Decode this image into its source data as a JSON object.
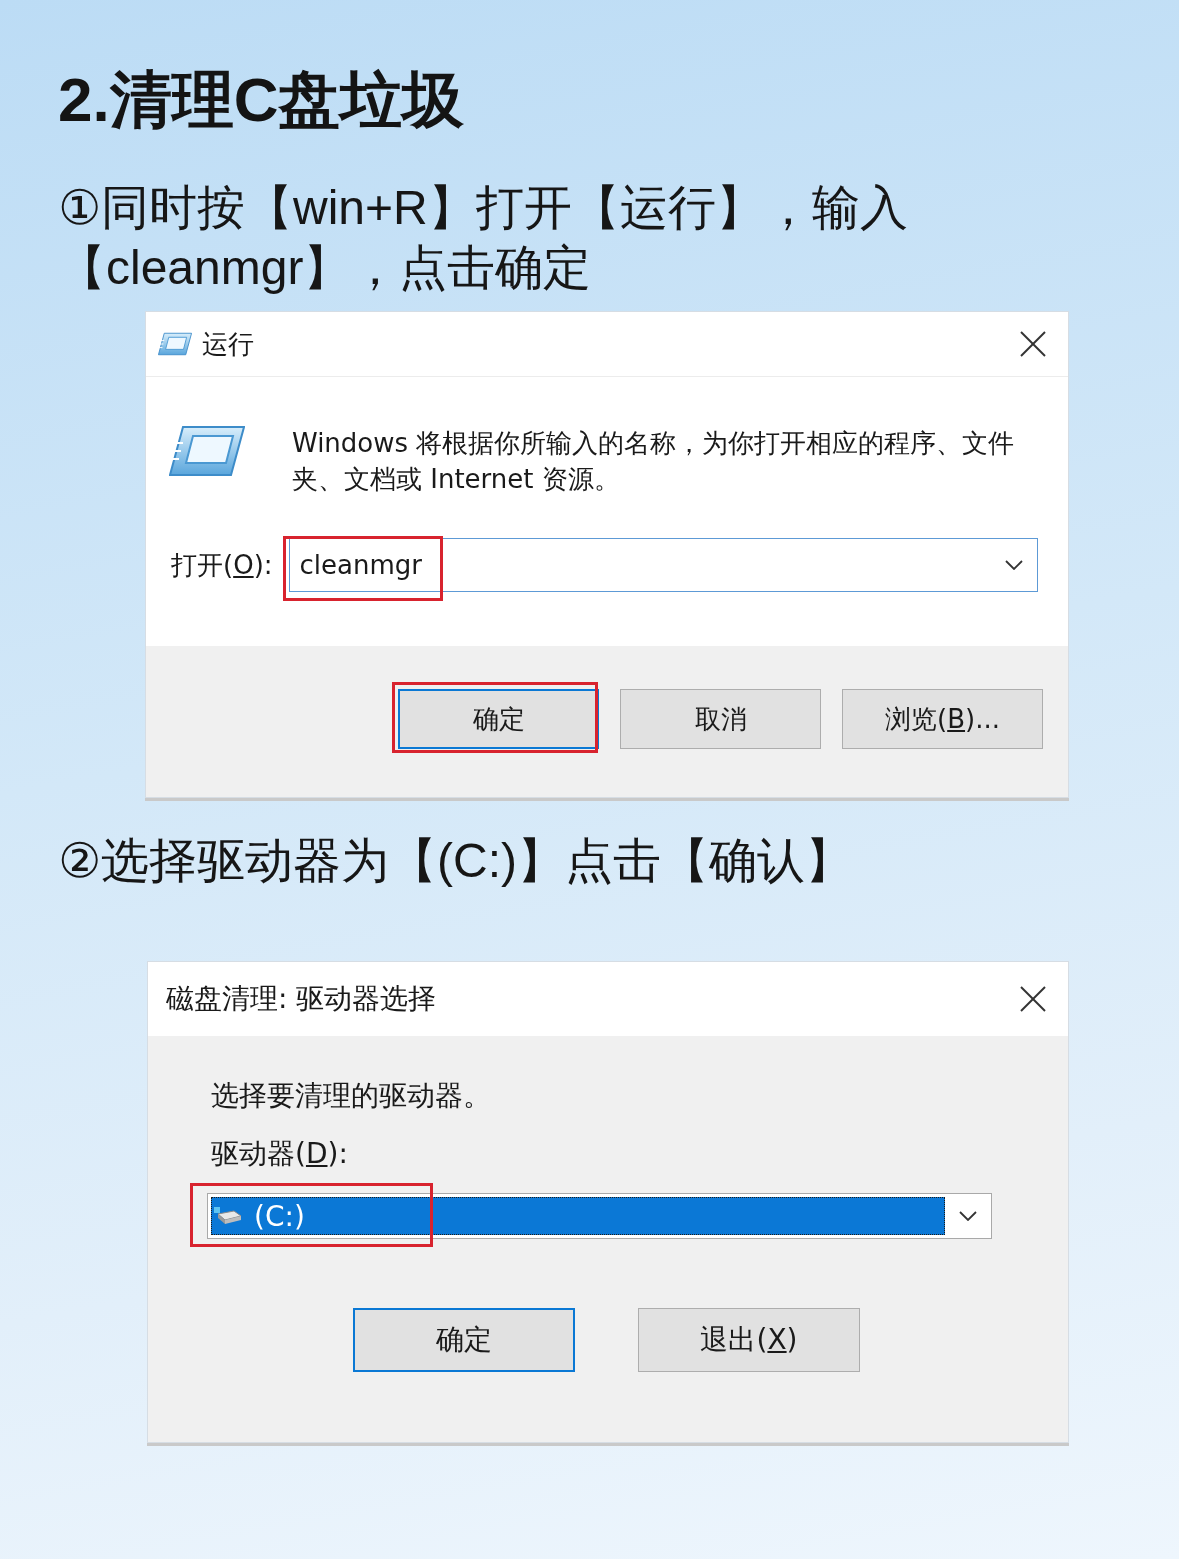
{
  "heading": "2.清理C盘垃圾",
  "sections": [
    {
      "instruction": "①同时按【win+R】打开【运行】，输入【cleanmgr】，点击确定",
      "dialog": {
        "kind": "run",
        "title": "运行",
        "description": "Windows 将根据你所输入的名称，为你打开相应的程序、文件夹、文档或 Internet 资源。",
        "field": {
          "label": "打开(O):",
          "mnemonic_underlined": true,
          "value": "cleanmgr",
          "highlighted": true,
          "focused": true
        },
        "buttons": [
          {
            "label": "确定",
            "default": true,
            "highlighted": true
          },
          {
            "label": "取消",
            "default": false,
            "highlighted": false
          },
          {
            "label": "浏览(B)...",
            "mnemonic_underlined": true,
            "default": false,
            "highlighted": false
          }
        ]
      }
    },
    {
      "instruction": "②选择驱动器为【(C:)】点击【确认】",
      "dialog": {
        "kind": "drive_select",
        "title": "磁盘清理: 驱动器选择",
        "prompt": "选择要清理的驱动器。",
        "field": {
          "label": "驱动器(D):",
          "mnemonic_underlined": true,
          "value": "(C:)",
          "highlighted": true,
          "focused": true
        },
        "buttons": [
          {
            "label": "确定",
            "default": true,
            "highlighted": false
          },
          {
            "label": "退出(X)",
            "mnemonic_underlined": true,
            "default": false,
            "highlighted": false
          }
        ]
      }
    }
  ]
}
